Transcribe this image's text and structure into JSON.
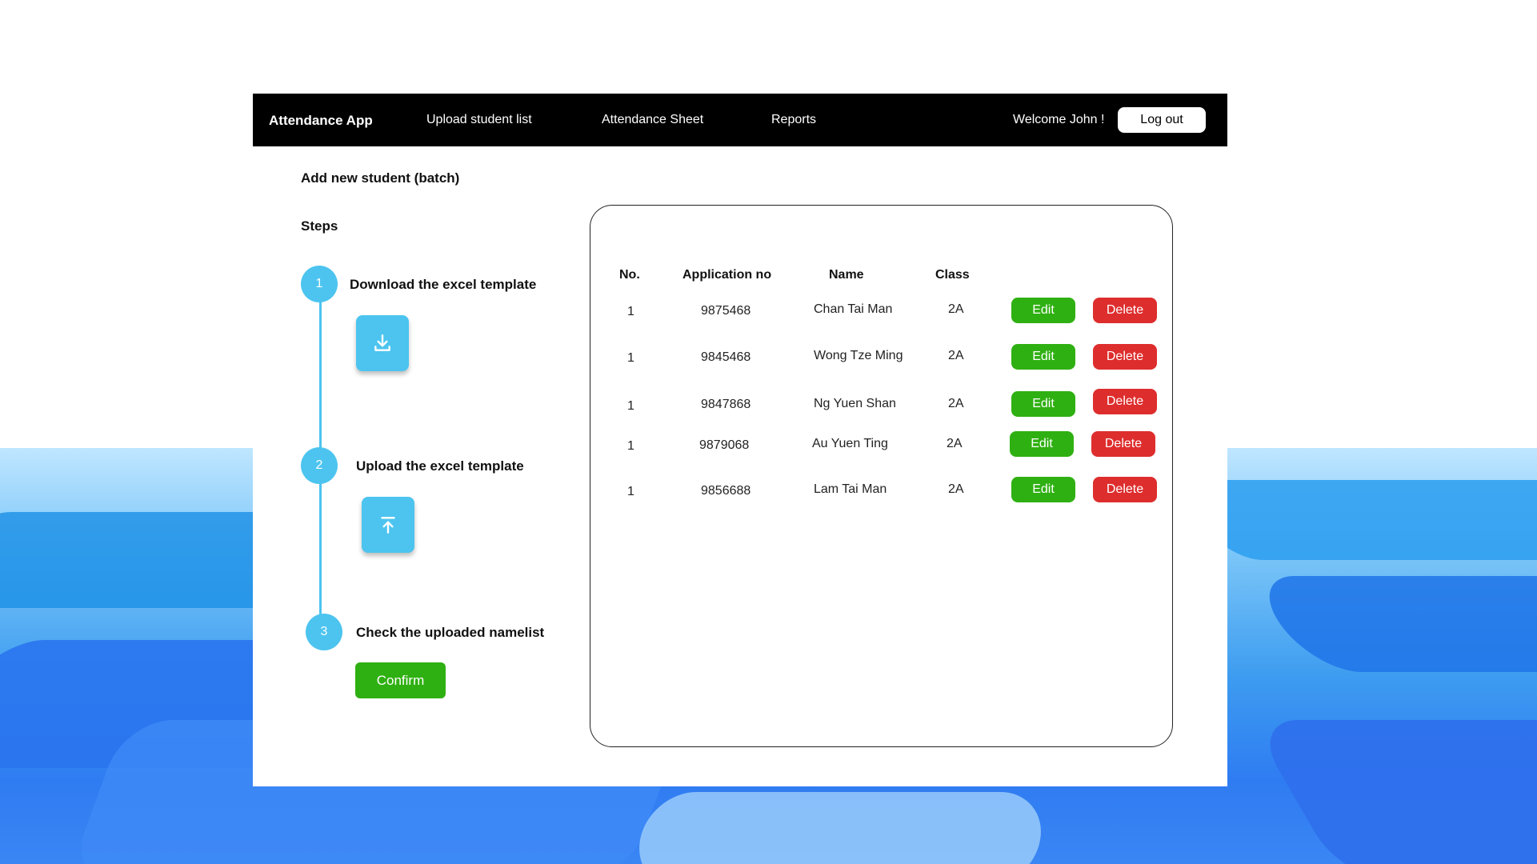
{
  "navbar": {
    "brand": "Attendance App",
    "links": [
      "Upload student list",
      "Attendance Sheet",
      "Reports"
    ],
    "welcome": "Welcome John !",
    "logout_label": "Log out"
  },
  "page": {
    "title": "Add new student (batch)",
    "steps_title": "Steps"
  },
  "steps": [
    {
      "number": "1",
      "label": "Download the excel template",
      "icon": "download-icon"
    },
    {
      "number": "2",
      "label": "Upload the excel template",
      "icon": "upload-icon"
    },
    {
      "number": "3",
      "label": "Check the uploaded namelist"
    }
  ],
  "confirm_label": "Confirm",
  "table": {
    "headers": [
      "No.",
      "Application no",
      "Name",
      "Class"
    ],
    "rows": [
      {
        "no": "1",
        "application_no": "9875468",
        "name": "Chan Tai Man",
        "class": "2A"
      },
      {
        "no": "1",
        "application_no": "9845468",
        "name": "Wong Tze Ming",
        "class": "2A"
      },
      {
        "no": "1",
        "application_no": "9847868",
        "name": "Ng Yuen Shan",
        "class": "2A"
      },
      {
        "no": "1",
        "application_no": "9879068",
        "name": "Au Yuen Ting",
        "class": "2A"
      },
      {
        "no": "1",
        "application_no": "9856688",
        "name": "Lam Tai Man",
        "class": "2A"
      }
    ],
    "edit_label": "Edit",
    "delete_label": "Delete"
  },
  "colors": {
    "accent": "#4cc4ef",
    "edit": "#2fb012",
    "delete": "#de2d2d",
    "navbar": "#000000"
  }
}
